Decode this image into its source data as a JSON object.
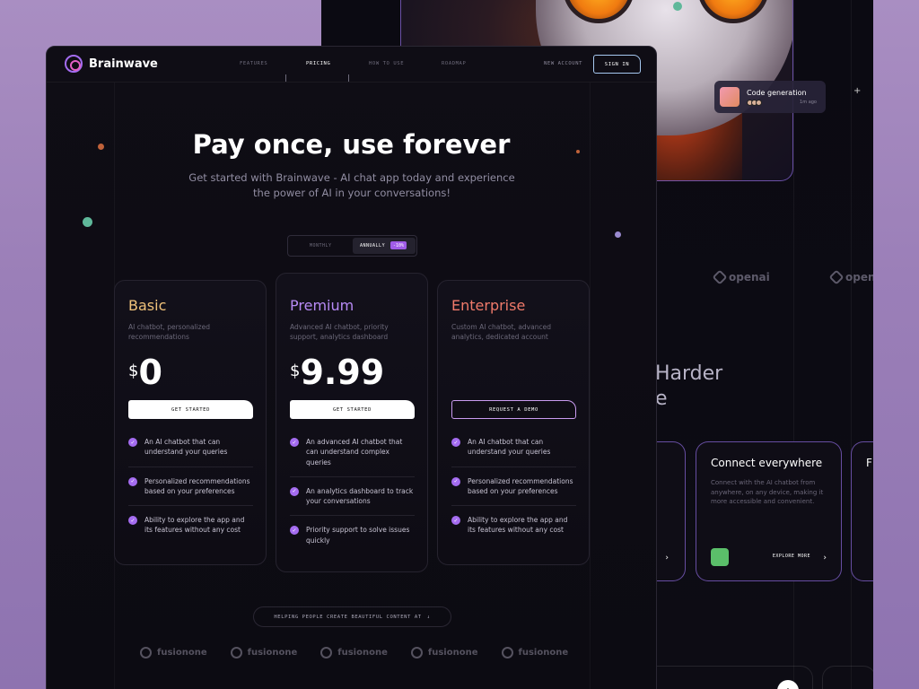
{
  "background_window": {
    "notification": {
      "title": "Code generation",
      "time": "1m ago"
    },
    "partners": [
      "openai",
      "openai"
    ],
    "heading_partial": [
      "Harder",
      "e"
    ],
    "feature_card": {
      "title": "Connect everywhere",
      "description": "Connect with the AI chatbot from anywhere, on any device, making it more accessible and convenient.",
      "link": "EXPLORE MORE"
    },
    "partial_card_title": "F"
  },
  "nav": {
    "brand": "Brainwave",
    "items": [
      "FEATURES",
      "PRICING",
      "HOW TO USE",
      "ROADMAP"
    ],
    "active": "PRICING",
    "new_account": "NEW ACCOUNT",
    "sign_in": "SIGN IN"
  },
  "hero": {
    "title": "Pay once, use forever",
    "subtitle": "Get started with Brainwave - AI chat app today and experience the power of AI in your conversations!"
  },
  "billing_toggle": {
    "monthly": "MONTHLY",
    "annually": "ANNUALLY",
    "discount": "-10%",
    "selected": "ANNUALLY"
  },
  "plans": [
    {
      "name": "Basic",
      "color": "#f0c27a",
      "description": "AI chatbot, personalized recommendations",
      "currency": "$",
      "price": "0",
      "cta": "GET STARTED",
      "features": [
        "An AI chatbot that can understand your queries",
        "Personalized recommendations based on your preferences",
        "Ability to explore the app and its features without any cost"
      ]
    },
    {
      "name": "Premium",
      "color": "#b78af5",
      "description": "Advanced AI chatbot, priority support, analytics dashboard",
      "currency": "$",
      "price": "9.99",
      "cta": "GET STARTED",
      "features": [
        "An advanced AI chatbot that can understand complex queries",
        "An analytics dashboard to track your conversations",
        "Priority support to solve issues quickly"
      ]
    },
    {
      "name": "Enterprise",
      "color": "#f07a6a",
      "description": "Custom AI chatbot, advanced analytics, dedicated account",
      "currency": "",
      "price": "",
      "cta": "REQUEST A DEMO",
      "features": [
        "An AI chatbot that can understand your queries",
        "Personalized recommendations based on your preferences",
        "Ability to explore the app and its features without any cost"
      ]
    }
  ],
  "helping": {
    "text": "HELPING PEOPLE CREATE BEAUTIFUL CONTENT AT"
  },
  "client_logos": [
    "fusionone",
    "fusionone",
    "fusionone",
    "fusionone",
    "fusionone"
  ]
}
